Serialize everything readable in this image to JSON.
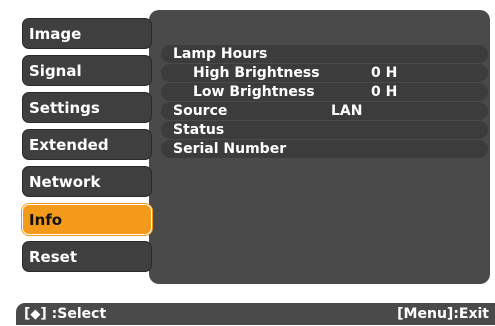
{
  "menu": {
    "items": [
      {
        "label": "Image"
      },
      {
        "label": "Signal"
      },
      {
        "label": "Settings"
      },
      {
        "label": "Extended"
      },
      {
        "label": "Network"
      },
      {
        "label": "Info"
      },
      {
        "label": "Reset"
      }
    ],
    "selected": "Info"
  },
  "info": {
    "lamp_hours": "Lamp Hours",
    "high_brightness": {
      "label": "High Brightness",
      "value": "0 H"
    },
    "low_brightness": {
      "label": "Low Brightness",
      "value": "0 H"
    },
    "source": {
      "label": "Source",
      "value": "LAN"
    },
    "status": {
      "label": "Status"
    },
    "serial_number": {
      "label": "Serial Number"
    }
  },
  "footer": {
    "select_prefix": "[",
    "select_icon": "up-down-arrow-icon",
    "select_suffix": "] :Select",
    "exit": "[Menu]:Exit"
  },
  "colors": {
    "highlight": "#f49a1b",
    "panel": "#4a4a4a"
  }
}
